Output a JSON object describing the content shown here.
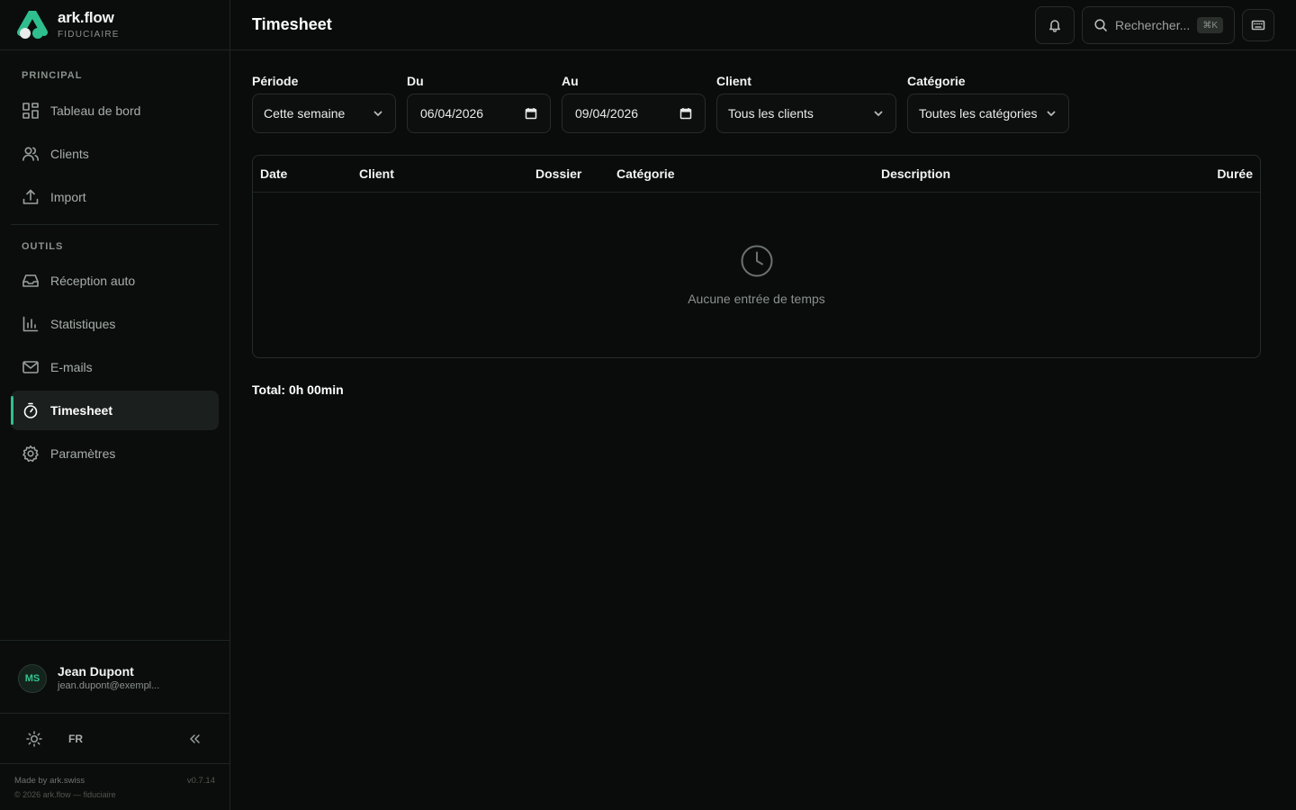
{
  "brand": {
    "name": "ark.flow",
    "subtitle": "FIDUCIAIRE",
    "accent": "#2fbf8e"
  },
  "sidebar": {
    "sections": [
      {
        "label": "PRINCIPAL"
      },
      {
        "label": "OUTILS"
      }
    ],
    "items": [
      {
        "label": "Tableau de bord",
        "icon": "dashboard-icon"
      },
      {
        "label": "Clients",
        "icon": "users-icon"
      },
      {
        "label": "Import",
        "icon": "upload-icon"
      },
      {
        "label": "Réception auto",
        "icon": "inbox-icon"
      },
      {
        "label": "Statistiques",
        "icon": "bar-chart-icon"
      },
      {
        "label": "E-mails",
        "icon": "mail-icon"
      },
      {
        "label": "Timesheet",
        "icon": "stopwatch-icon",
        "active": true
      },
      {
        "label": "Paramètres",
        "icon": "gear-icon"
      }
    ]
  },
  "user": {
    "initials": "MS",
    "name": "Jean Dupont",
    "email": "jean.dupont@exempl..."
  },
  "prefs": {
    "language": "FR"
  },
  "footer": {
    "made_by": "Made by  ark.swiss",
    "copyright": "© 2026 ark.flow — fiduciaire",
    "version": "v0.7.14"
  },
  "header": {
    "title": "Timesheet",
    "search_placeholder": "Rechercher...",
    "search_shortcut": "⌘K"
  },
  "filters": {
    "period": {
      "label": "Période",
      "value": "Cette semaine"
    },
    "from": {
      "label": "Du",
      "value": "06/04/2026"
    },
    "to": {
      "label": "Au",
      "value": "09/04/2026"
    },
    "client": {
      "label": "Client",
      "value": "Tous les clients"
    },
    "category": {
      "label": "Catégorie",
      "value": "Toutes les catégories"
    }
  },
  "table": {
    "columns": [
      "Date",
      "Client",
      "Dossier",
      "Catégorie",
      "Description",
      "Durée"
    ],
    "empty_message": "Aucune entrée de temps"
  },
  "summary": {
    "total": "Total: 0h 00min"
  }
}
